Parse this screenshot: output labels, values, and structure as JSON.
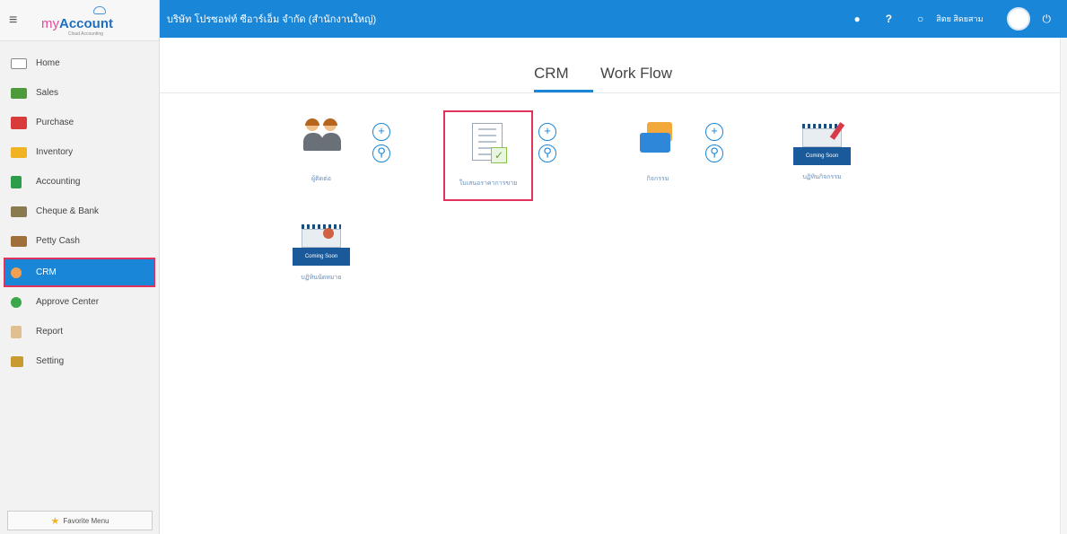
{
  "app": {
    "logo_my": "my",
    "logo_account": "Account",
    "logo_tagline": "Cloud Accounting"
  },
  "topbar": {
    "company_name": "บริษัท โปรซอฟท์ ซีอาร์เอ็ม จำกัด (สำนักงานใหญ่)",
    "username": "สิตย สิดยสาม"
  },
  "sidebar": {
    "items": [
      {
        "label": "Home",
        "icon": "home-icon"
      },
      {
        "label": "Sales",
        "icon": "sales-icon"
      },
      {
        "label": "Purchase",
        "icon": "purchase-icon"
      },
      {
        "label": "Inventory",
        "icon": "inventory-icon"
      },
      {
        "label": "Accounting",
        "icon": "accounting-icon"
      },
      {
        "label": "Cheque & Bank",
        "icon": "cheque-bank-icon"
      },
      {
        "label": "Petty Cash",
        "icon": "petty-cash-icon"
      },
      {
        "label": "CRM",
        "icon": "crm-icon",
        "active": true
      },
      {
        "label": "Approve Center",
        "icon": "approve-icon"
      },
      {
        "label": "Report",
        "icon": "report-icon"
      },
      {
        "label": "Setting",
        "icon": "setting-icon"
      }
    ],
    "favorite_label": "Favorite Menu"
  },
  "main": {
    "tabs": [
      {
        "label": "CRM",
        "active": true
      },
      {
        "label": "Work Flow",
        "active": false
      }
    ],
    "tiles": [
      {
        "label": "ผู้ติดต่อ"
      },
      {
        "label": "ใบเสนอราคาการขาย"
      },
      {
        "label": "กิจกรรม"
      },
      {
        "label": "บฏิทินกิจกรรม",
        "badge": "Coming Soon"
      },
      {
        "label": "บฏิทินนัดหมาย",
        "badge": "Coming Soon"
      }
    ]
  },
  "colors": {
    "primary": "#1a86d8",
    "highlight": "#e0325a"
  }
}
